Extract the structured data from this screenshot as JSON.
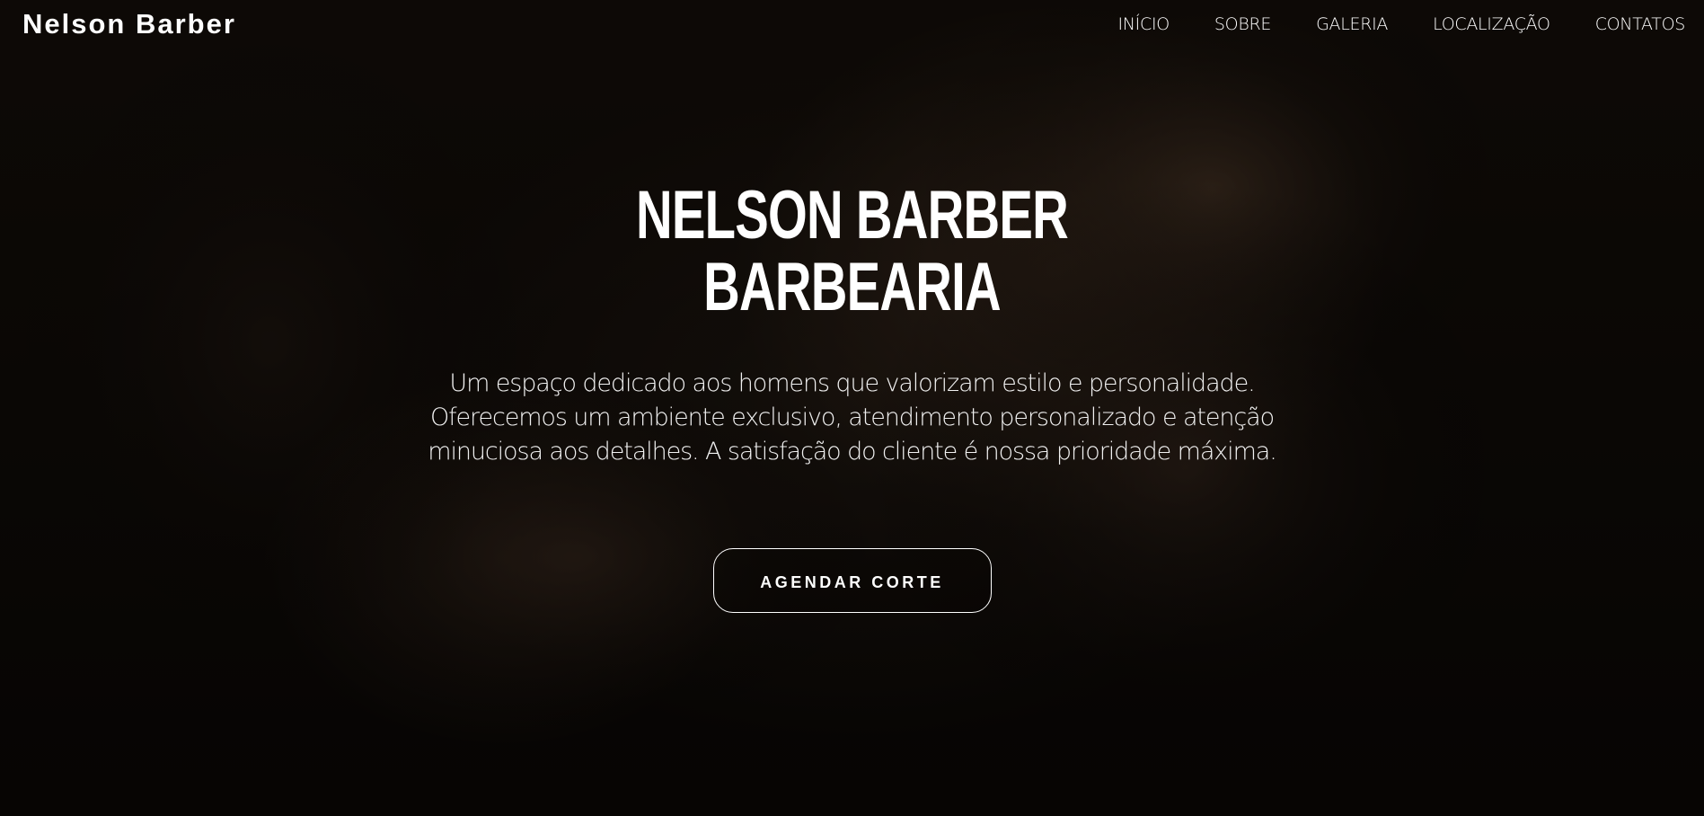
{
  "header": {
    "brand": "Nelson Barber",
    "nav": [
      {
        "label": "INÍCIO"
      },
      {
        "label": "SOBRE"
      },
      {
        "label": "GALERIA"
      },
      {
        "label": "LOCALIZAÇÃO"
      },
      {
        "label": "CONTATOS"
      }
    ]
  },
  "hero": {
    "title_line1": "NELSON BARBER",
    "title_line2": "BARBEARIA",
    "description": "Um espaço dedicado aos homens que valorizam estilo e personalidade. Oferecemos um ambiente exclusivo, atendimento personalizado e atenção minuciosa aos detalhes. A satisfação do cliente é nossa prioridade máxima.",
    "cta_label": "AGENDAR CORTE"
  },
  "colors": {
    "background": "#0c0906",
    "text": "#ffffff"
  }
}
